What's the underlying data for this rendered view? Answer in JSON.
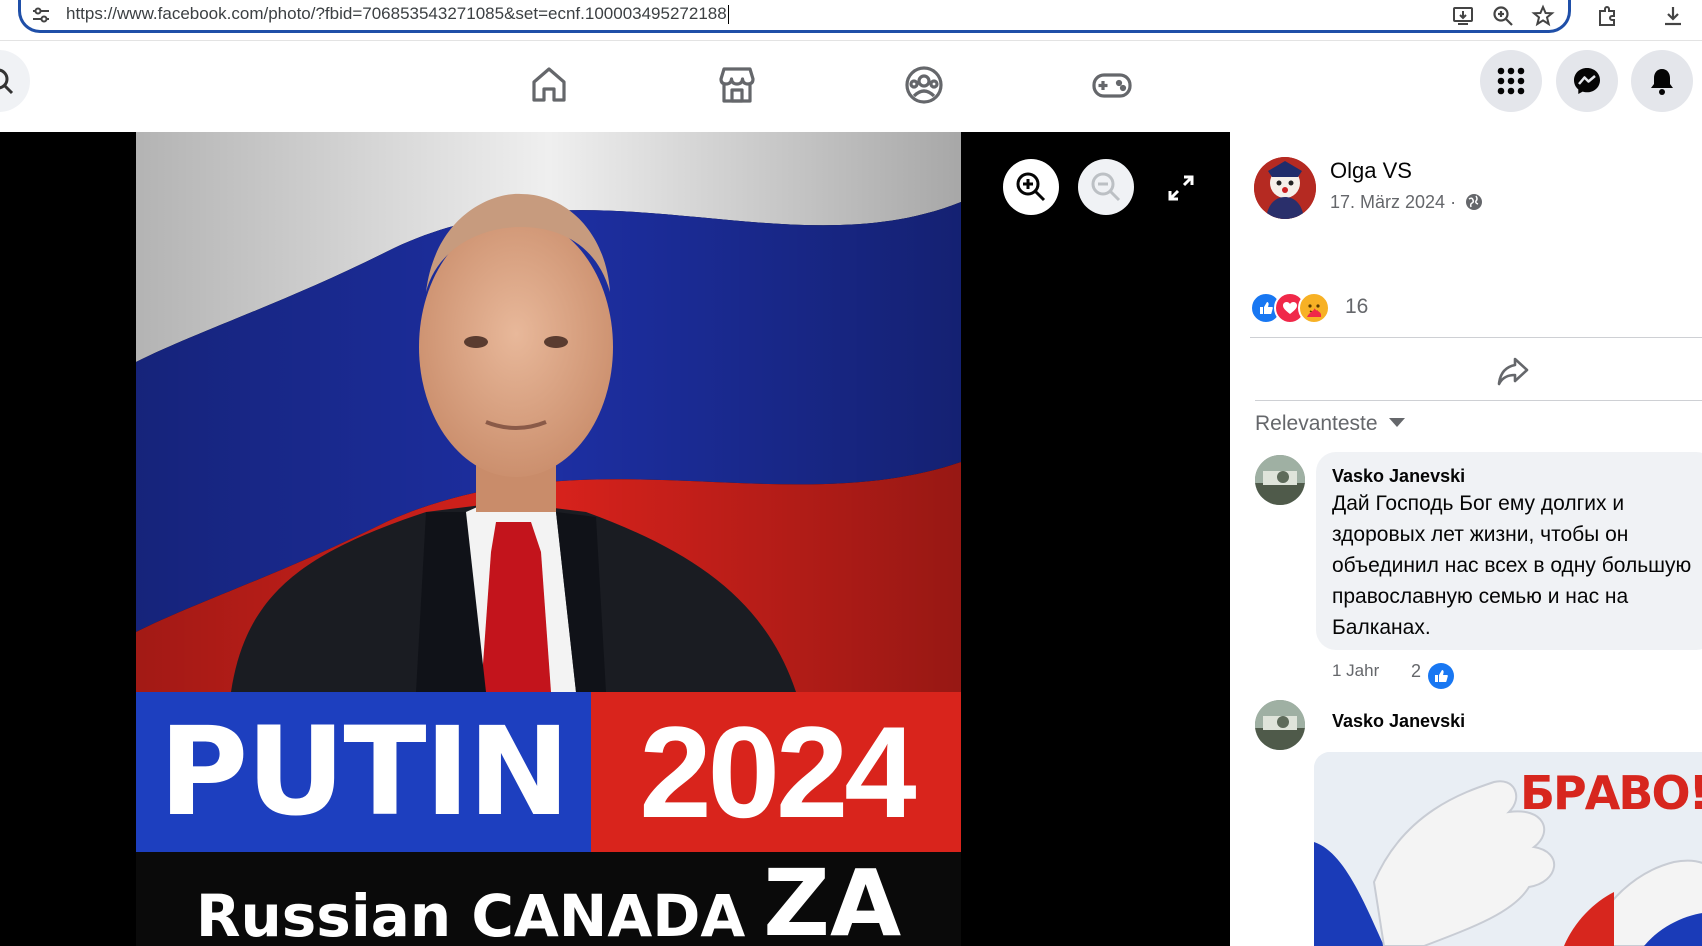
{
  "browser": {
    "url": "https://www.facebook.com/photo/?fbid=706853543271085&set=ecnf.100003495272188",
    "icons": [
      "site-settings-icon",
      "install-app-icon",
      "zoom-icon",
      "bookmark-star-icon",
      "extensions-icon",
      "downloads-icon"
    ]
  },
  "nav": {
    "icons": [
      "home-icon",
      "marketplace-icon",
      "groups-icon",
      "gaming-icon",
      "menu-grid-icon",
      "messenger-icon",
      "notifications-bell-icon"
    ]
  },
  "photo": {
    "poster_name": "PUTIN",
    "poster_year": "2024",
    "poster_bottom_a": "Russian CANADA",
    "poster_bottom_b": "ZA",
    "colors": {
      "blue": "#1d3fbf",
      "red": "#d9241c",
      "white": "#ffffff"
    }
  },
  "post": {
    "author": "Olga VS",
    "date": "17. März 2024 ·",
    "privacy_icon": "globe-icon",
    "reaction_icons": [
      "like-icon",
      "love-icon",
      "care-icon"
    ],
    "reaction_count": "16",
    "share_icon": "share-icon"
  },
  "comments": {
    "sort_label": "Relevanteste",
    "items": [
      {
        "author": "Vasko Janevski",
        "text": "Дай Господь Бог ему долгих и здоровых лет жизни, чтобы он объединил нас всех в одну большую православную семью и нас на Балканах.",
        "time": "1 Jahr",
        "likes": "2"
      },
      {
        "author": "Vasko Janevski",
        "image_text": "БРАВО!!!"
      }
    ]
  },
  "accent": "#0866ff"
}
